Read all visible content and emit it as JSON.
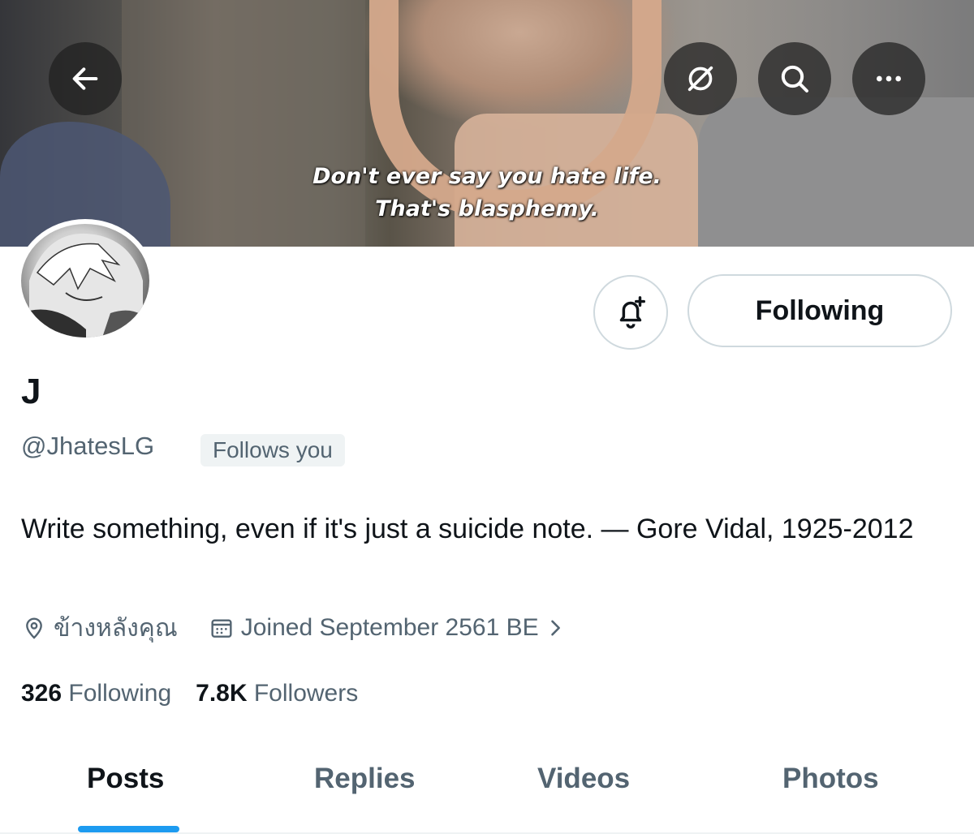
{
  "banner": {
    "subtitle_line1": "Don't ever say you hate life.",
    "subtitle_line2": "That's blasphemy."
  },
  "header_buttons": {
    "back": "arrow-left-icon",
    "grok": "grok-icon",
    "search": "search-icon",
    "more": "more-horizontal-icon"
  },
  "profile": {
    "display_name": "J",
    "handle": "@JhatesLG",
    "follows_you": "Follows you",
    "bio": "Write something, even if it's just a suicide note. — Gore Vidal, 1925-2012",
    "location": "ข้างหลังคุณ",
    "joined": "Joined September 2561 BE"
  },
  "actions": {
    "following_label": "Following"
  },
  "stats": {
    "following_count": "326",
    "following_label": "Following",
    "followers_count": "7.8K",
    "followers_label": "Followers"
  },
  "tabs": [
    {
      "label": "Posts",
      "active": true
    },
    {
      "label": "Replies",
      "active": false
    },
    {
      "label": "Videos",
      "active": false
    },
    {
      "label": "Photos",
      "active": false
    }
  ],
  "colors": {
    "accent": "#1d9bf0",
    "secondary_text": "#536471",
    "primary_text": "#0f1419",
    "border": "#cfd9de"
  }
}
